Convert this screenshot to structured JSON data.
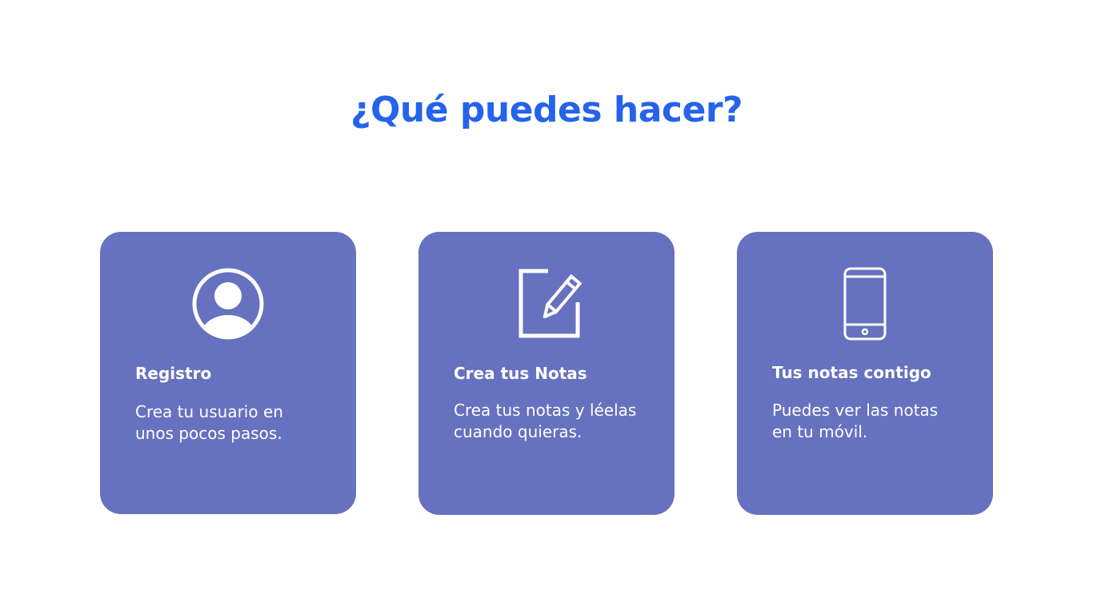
{
  "header": {
    "title": "¿Qué puedes hacer?"
  },
  "colors": {
    "title": "#2563eb",
    "card_background": "#6671bf",
    "card_text": "#ffffff",
    "page_background": "#ffffff"
  },
  "cards": [
    {
      "icon": "user-circle-icon",
      "heading": "Registro",
      "text_line_1": "Crea tu usuario en",
      "text_line_2": "unos pocos pasos."
    },
    {
      "icon": "edit-note-icon",
      "heading": "Crea tus Notas",
      "text_line_1": "Crea tus notas y léelas",
      "text_line_2": "cuando quieras."
    },
    {
      "icon": "smartphone-icon",
      "heading": "Tus notas contigo",
      "text_line_1": "Puedes ver las notas",
      "text_line_2": "en tu móvil."
    }
  ]
}
